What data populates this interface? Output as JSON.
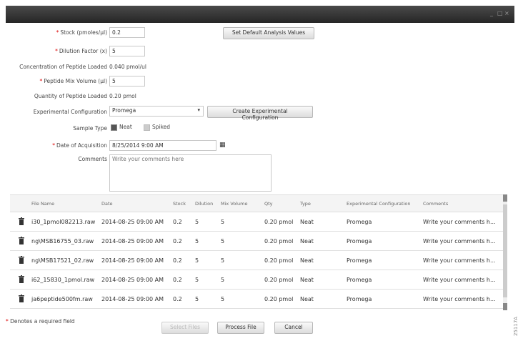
{
  "window": {
    "controls": [
      "_",
      "□",
      "×"
    ]
  },
  "form": {
    "stock": {
      "label": "Stock (pmoles/µl)",
      "value": "0.2"
    },
    "dilution": {
      "label": "Dilution Factor (x)",
      "value": "5"
    },
    "concentration": {
      "label": "Concentration of Peptide Loaded",
      "value": "0.040 pmol/ul"
    },
    "peptide_mix": {
      "label": "Peptide Mix Volume (µl)",
      "value": "5"
    },
    "quantity": {
      "label": "Quantity of Peptide Loaded",
      "value": "0.20 pmol"
    },
    "exp_config": {
      "label": "Experimental Configuration",
      "value": "Promega"
    },
    "sample_type": {
      "label": "Sample Type",
      "neat": "Neat",
      "spiked": "Spiked"
    },
    "date": {
      "label": "Date of Acquisition",
      "value": "8/25/2014 9:00 AM"
    },
    "comments": {
      "label": "Comments",
      "placeholder": "Write your comments here"
    },
    "set_default_btn": "Set Default Analysis Values",
    "create_config_btn": "Create Experimental Configuration"
  },
  "table": {
    "headers": [
      "File Name",
      "Date",
      "Stock",
      "Dilution",
      "Mix Volume",
      "Qty",
      "Type",
      "Experimental Configuration",
      "Comments"
    ],
    "rows": [
      [
        "i30_1pmol082213.raw",
        "2014-08-25 09:00 AM",
        "0.2",
        "5",
        "5",
        "0.20 pmol",
        "Neat",
        "Promega",
        "Write your comments h..."
      ],
      [
        "ng\\MSB16755_03.raw",
        "2014-08-25 09:00 AM",
        "0.2",
        "5",
        "5",
        "0.20 pmol",
        "Neat",
        "Promega",
        "Write your comments h..."
      ],
      [
        "ng\\MSB17521_02.raw",
        "2014-08-25 09:00 AM",
        "0.2",
        "5",
        "5",
        "0.20 pmol",
        "Neat",
        "Promega",
        "Write your comments h..."
      ],
      [
        "i62_15830_1pmol.raw",
        "2014-08-25 09:00 AM",
        "0.2",
        "5",
        "5",
        "0.20 pmol",
        "Neat",
        "Promega",
        "Write your comments h..."
      ],
      [
        "ja6peptide500fm.raw",
        "2014-08-25 09:00 AM",
        "0.2",
        "5",
        "5",
        "0.20 pmol",
        "Neat",
        "Promega",
        "Write your comments h..."
      ]
    ]
  },
  "footer": {
    "required_note": "* Denotes a required field",
    "select_files": "Select Files",
    "process_file": "Process File",
    "cancel": "Cancel"
  },
  "side_code": "25117A",
  "colors": {
    "required": "#dd0000",
    "titlebar": "#333333"
  }
}
